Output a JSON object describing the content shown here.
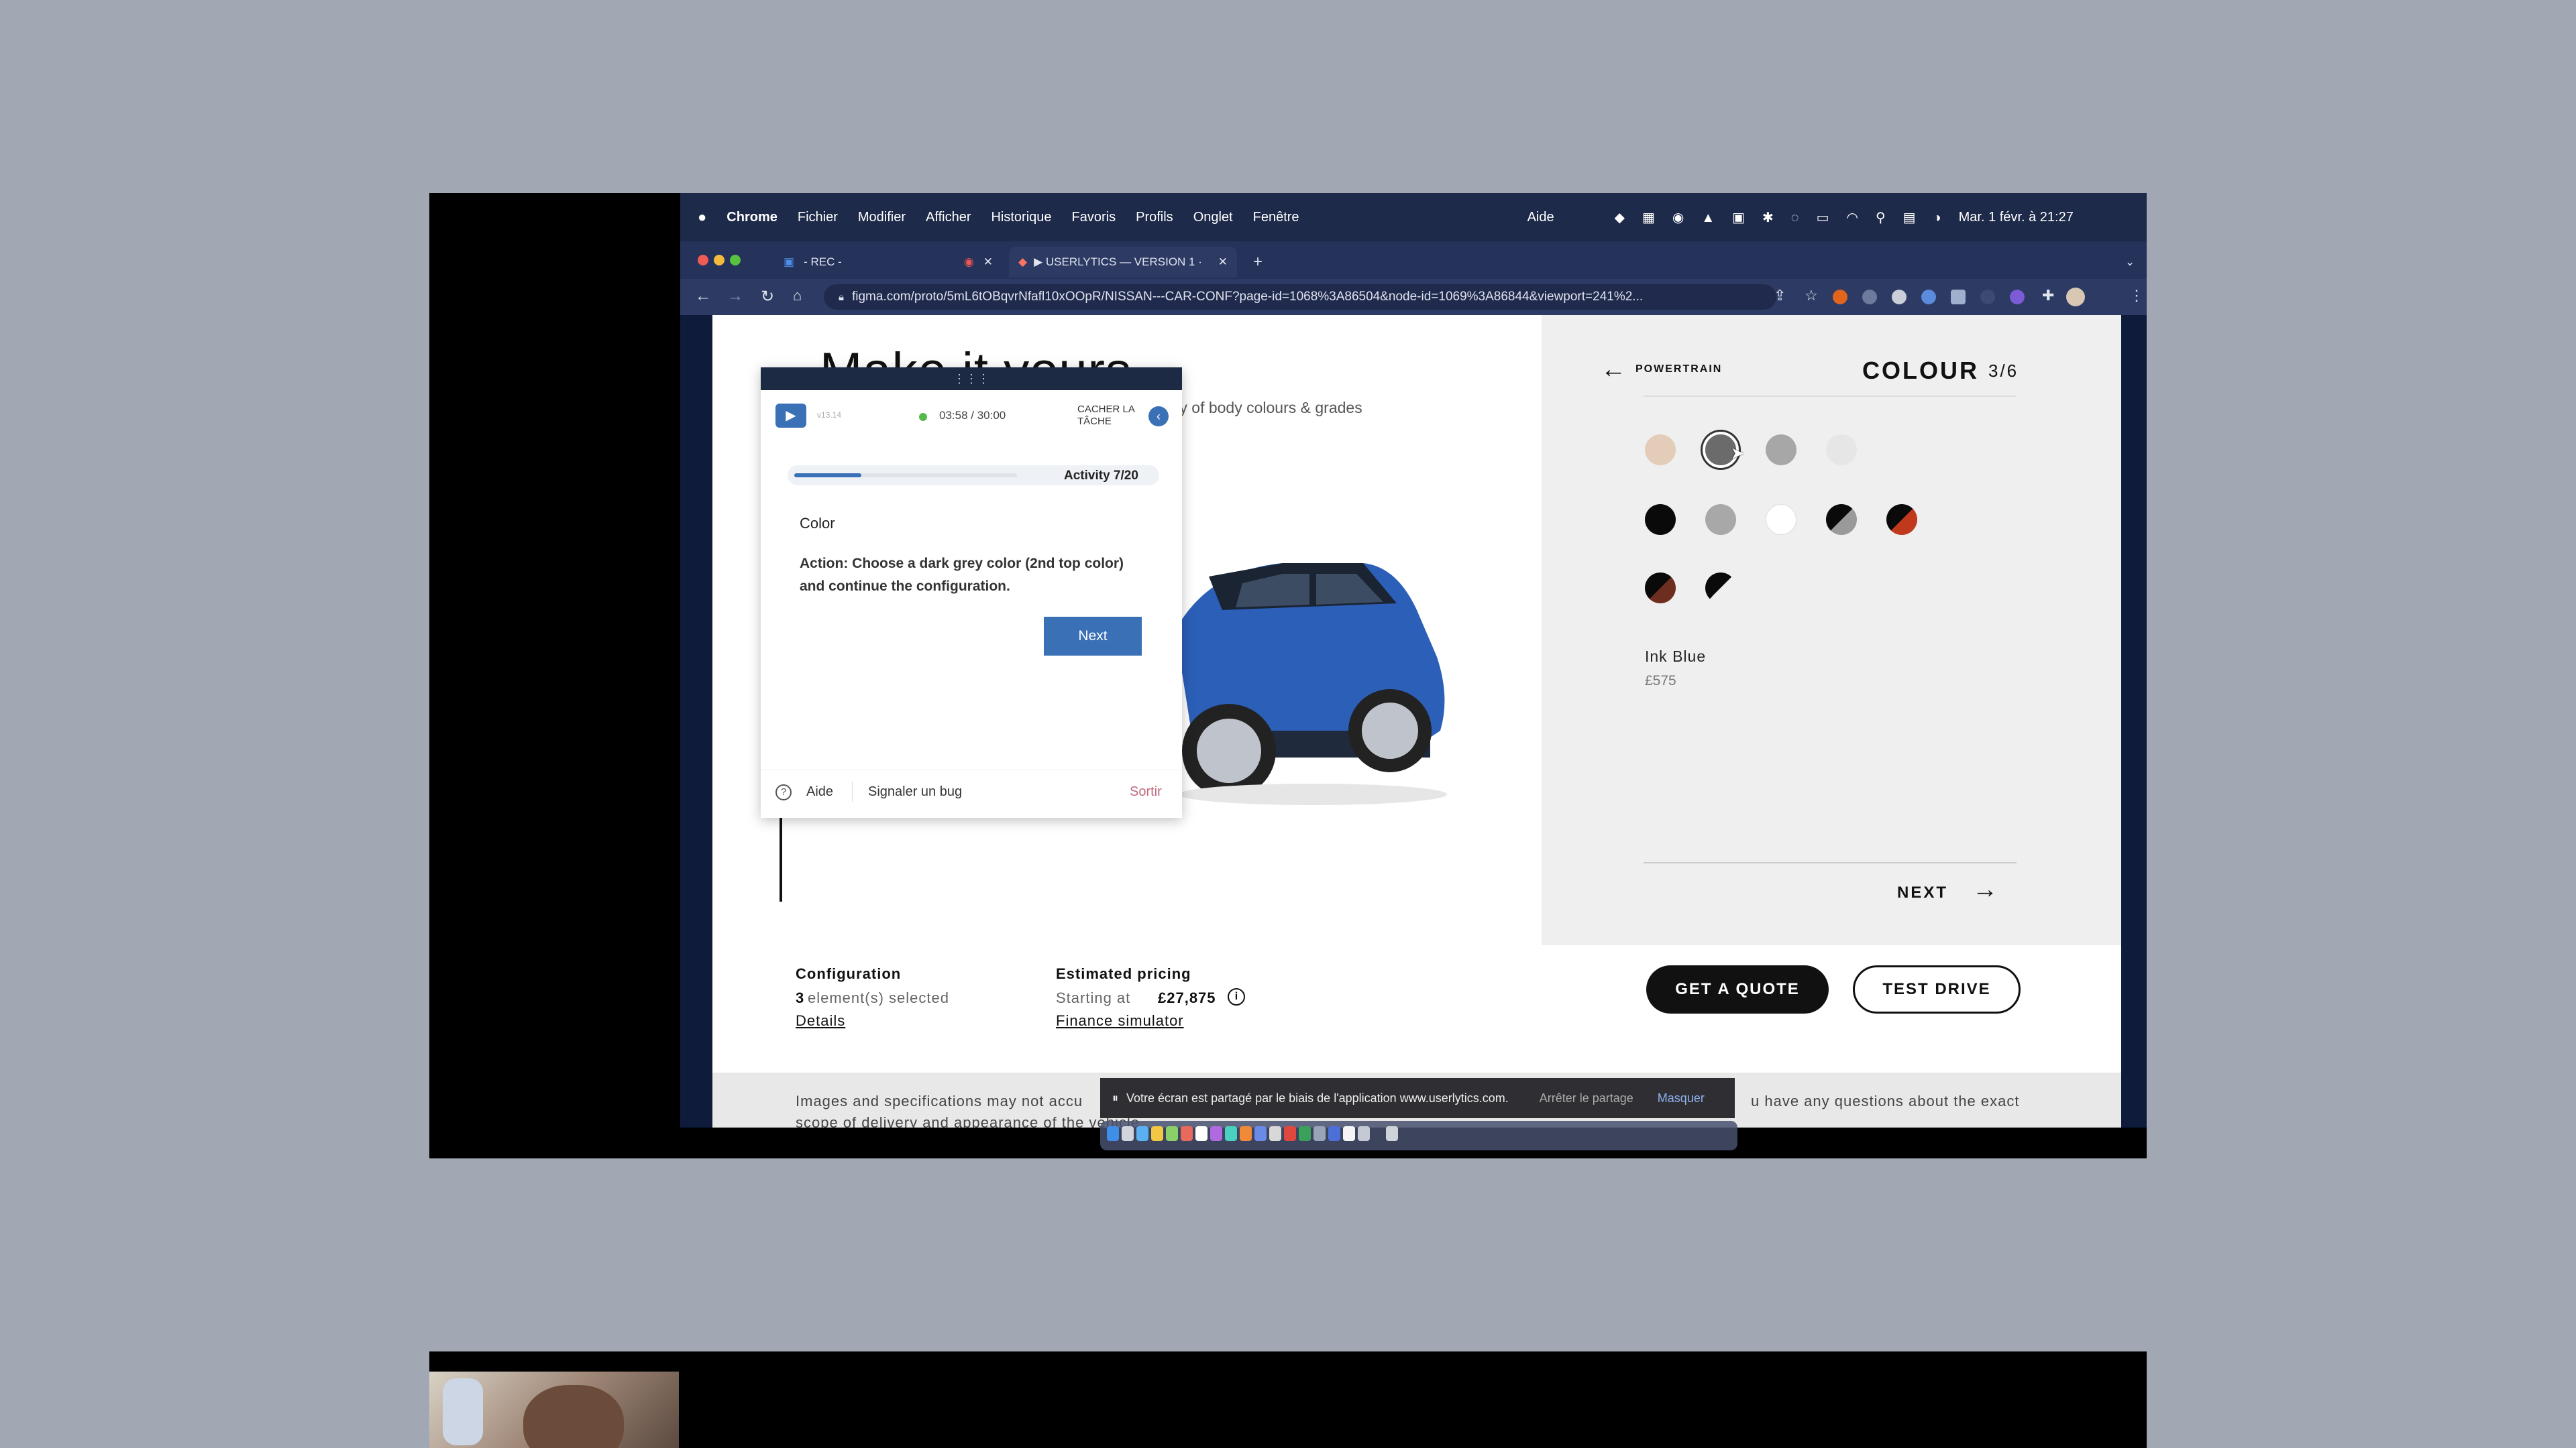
{
  "menubar": {
    "app": "Chrome",
    "items": [
      "Fichier",
      "Modifier",
      "Afficher",
      "Historique",
      "Favoris",
      "Profils",
      "Onglet",
      "Fenêtre"
    ],
    "help": "Aide",
    "datetime": "Mar. 1 févr. à 21:27"
  },
  "tabs": [
    {
      "label": "- REC -"
    },
    {
      "label": "▶ USERLYTICS — VERSION 1 ·"
    }
  ],
  "url": "figma.com/proto/5mL6tOBqvrNfafl10xOOpR/NISSAN---CAR-CONF?page-id=1068%3A86504&node-id=1069%3A86844&viewport=241%2...",
  "page": {
    "title": "Make it yours",
    "subtitle": "ty of body colours & grades",
    "right_panel": {
      "back_label": "POWERTRAIN",
      "section_title": "COLOUR",
      "step": "3/6",
      "selected_color_name": "Ink Blue",
      "selected_color_price": "£575",
      "next_label": "NEXT"
    },
    "config": {
      "heading": "Configuration",
      "count": "3",
      "count_suffix": "element(s) selected",
      "details_link": "Details"
    },
    "pricing": {
      "heading": "Estimated pricing",
      "starting_prefix": "Starting at",
      "price": "£27,875",
      "finance_link": "Finance simulator"
    },
    "buttons": {
      "quote": "GET A QUOTE",
      "test_drive": "TEST DRIVE"
    },
    "disclaimer_left": "Images and specifications may not accu",
    "disclaimer_left2": "scope of delivery and appearance of the vehicle",
    "disclaimer_right": "u have any questions about the exact"
  },
  "swatches": {
    "row1": [
      "#e3cdb9",
      "#6b6b6b",
      "#a7a7a7",
      "#e6e6e6"
    ],
    "row2": [
      "#0a0a0a",
      "#a8a8a8",
      "#ffffff",
      "split-grey-black",
      "split-red-black"
    ],
    "row3": [
      "split-red-black",
      "split-black-white"
    ],
    "selected_index": 1
  },
  "task": {
    "timer": "03:58 / 30:00",
    "hide_label_line1": "CACHER LA",
    "hide_label_line2": "TÂCHE",
    "small_label": "v13.14",
    "activity": "Activity 7/20",
    "activity_progress": 0.3,
    "heading": "Color",
    "action": "Action: Choose a dark grey color (2nd top color) and continue the configuration.",
    "next_button": "Next",
    "help": "Aide",
    "report_bug": "Signaler un bug",
    "exit": "Sortir"
  },
  "share_bar": {
    "message": "Votre écran est partagé par le biais de l'application www.userlytics.com.",
    "stop": "Arrêter le partage",
    "hide": "Masquer"
  },
  "colors": {
    "accent_blue": "#3a70b6",
    "exit_pink": "#c06a7e",
    "mac_menubar": "#1e2a4a"
  }
}
